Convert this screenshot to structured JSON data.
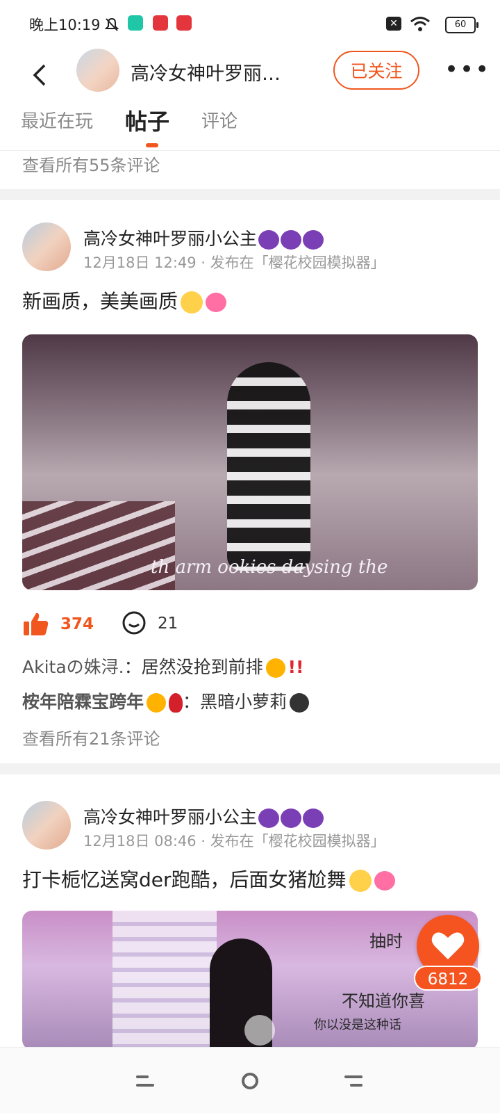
{
  "status_bar": {
    "time": "晚上10:19",
    "battery": "60",
    "icons": [
      "mute-icon",
      "app-icon",
      "app-icon",
      "app-icon",
      "sim-off-icon",
      "wifi-icon",
      "battery-icon"
    ]
  },
  "header": {
    "title": "高冷女神叶罗丽…",
    "follow_label": "已关注",
    "more_label": "•••"
  },
  "tabs": [
    {
      "label": "最近在玩",
      "active": false
    },
    {
      "label": "帖子",
      "active": true
    },
    {
      "label": "评论",
      "active": false
    }
  ],
  "prev_view_all": "查看所有55条评论",
  "posts": [
    {
      "author": "高冷女神叶罗丽小公主",
      "meta": "12月18日 12:49 · 发布在「樱花校园模拟器」",
      "text": "新画质，美美画质",
      "video_caption": "th arm ookies daysing the",
      "likes": "374",
      "comments_count": "21",
      "comments": [
        {
          "user": "Akitaの姝浔.",
          "text": "：居然没抢到前排"
        },
        {
          "user": "桉年陪霖宝跨年",
          "text": "：黑暗小萝莉"
        }
      ],
      "view_all": "查看所有21条评论"
    },
    {
      "author": "高冷女神叶罗丽小公主",
      "meta": "12月18日 08:46 · 发布在「樱花校园模拟器」",
      "text": "打卡栀忆送窝der跑酷，后面女猪尬舞",
      "video_text_1": "抽时",
      "video_text_2": "不知道你喜",
      "video_text_3": "你以没是这种话"
    }
  ],
  "fab": {
    "count": "6812"
  },
  "colors": {
    "accent": "#f0561e",
    "text": "#222222",
    "muted": "#999999"
  }
}
